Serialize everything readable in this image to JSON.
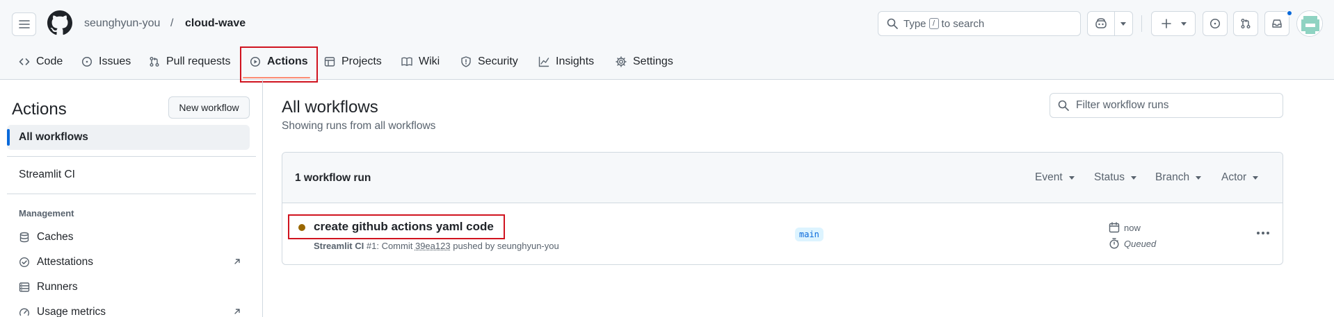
{
  "header": {
    "owner": "seunghyun-you",
    "separator": "/",
    "repo": "cloud-wave",
    "search": {
      "prefix": "Type",
      "key": "/",
      "suffix": "to search"
    }
  },
  "tabs": [
    {
      "label": "Code",
      "icon": "code-icon"
    },
    {
      "label": "Issues",
      "icon": "issue-opened-icon"
    },
    {
      "label": "Pull requests",
      "icon": "git-pull-request-icon"
    },
    {
      "label": "Actions",
      "icon": "play-icon",
      "active": true
    },
    {
      "label": "Projects",
      "icon": "table-icon"
    },
    {
      "label": "Wiki",
      "icon": "book-icon"
    },
    {
      "label": "Security",
      "icon": "shield-icon"
    },
    {
      "label": "Insights",
      "icon": "graph-icon"
    },
    {
      "label": "Settings",
      "icon": "gear-icon"
    }
  ],
  "sidebar": {
    "title": "Actions",
    "new_workflow": "New workflow",
    "all_workflows": "All workflows",
    "workflows": [
      "Streamlit CI"
    ],
    "management_heading": "Management",
    "management": [
      {
        "label": "Caches",
        "icon": "database-icon"
      },
      {
        "label": "Attestations",
        "icon": "verified-icon"
      },
      {
        "label": "Runners",
        "icon": "server-icon"
      },
      {
        "label": "Usage metrics",
        "icon": "meter-icon"
      }
    ]
  },
  "main": {
    "title": "All workflows",
    "subtitle": "Showing runs from all workflows",
    "filter_placeholder": "Filter workflow runs",
    "runs_count": "1 workflow run",
    "filters": [
      "Event",
      "Status",
      "Branch",
      "Actor"
    ],
    "runs": [
      {
        "title": "create github actions yaml code",
        "workflow": "Streamlit CI",
        "number": "#1",
        "commit_label": ": Commit",
        "sha": "39ea123",
        "pushed_by": "pushed by seunghyun-you",
        "branch": "main",
        "time": "now",
        "status": "Queued"
      }
    ]
  },
  "colors": {
    "queued_dot": "#9a6700",
    "highlight": "#d0131f",
    "accent": "#0969da",
    "tab_underline": "#fd8c73"
  }
}
